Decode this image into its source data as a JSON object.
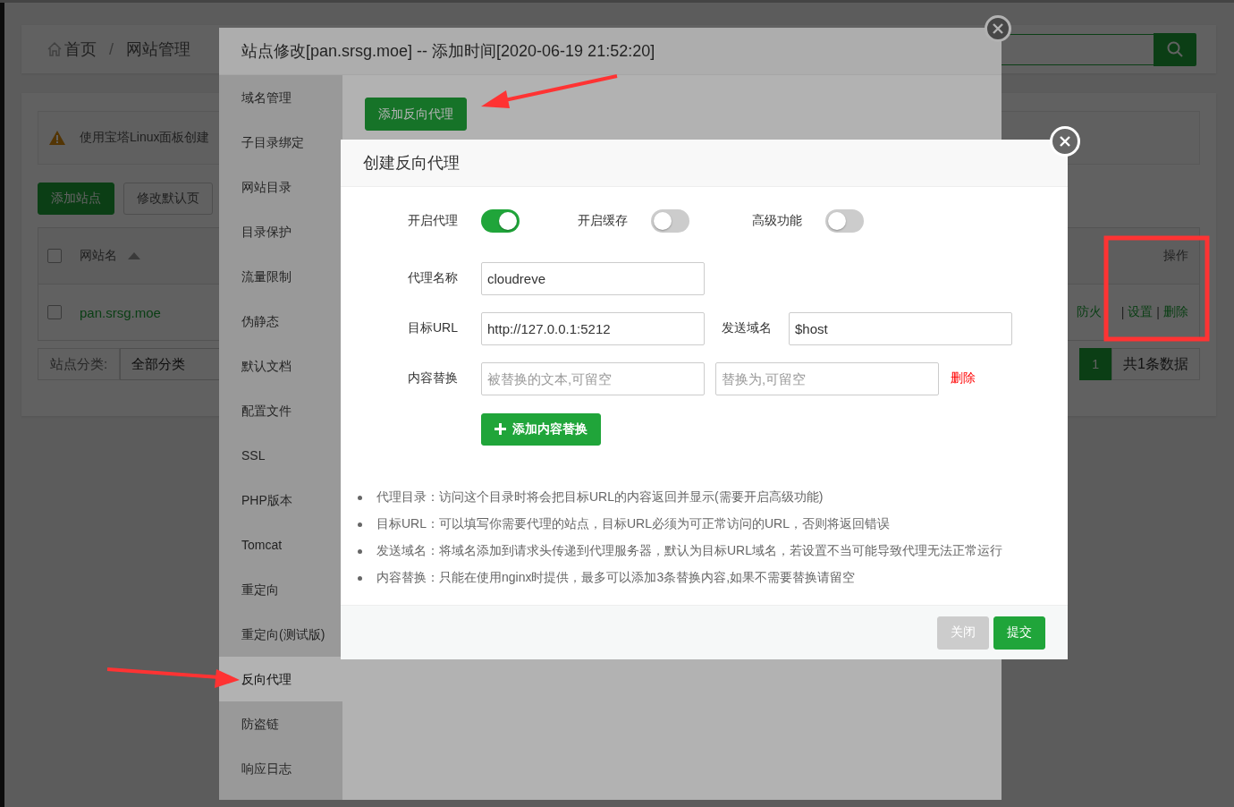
{
  "breadcrumb": {
    "items": [
      {
        "label": "首页"
      },
      {
        "label": "网站管理"
      }
    ],
    "separator": "/"
  },
  "notice": "使用宝塔Linux面板创建",
  "toolbar_buttons": [
    {
      "label": "添加站点",
      "primary": true
    },
    {
      "label": "修改默认页",
      "primary": false
    }
  ],
  "site_table": {
    "header_checked": false,
    "columns": [
      "网站名",
      "操作"
    ],
    "action_separator": "|",
    "rows": [
      {
        "checked": false,
        "name": "pan.srsg.moe",
        "actions": [
          "防火",
          "设置",
          "删除"
        ]
      }
    ]
  },
  "category": {
    "label": "站点分类:",
    "value": "全部分类"
  },
  "pagination": {
    "pages": [
      {
        "label": "1",
        "selected": true
      }
    ],
    "total": "共1条数据"
  },
  "site_dialog": {
    "title": "站点修改[pan.srsg.moe] -- 添加时间[2020-06-19 21:52:20]",
    "tabs": [
      {
        "label": "域名管理",
        "selected": false
      },
      {
        "label": "子目录绑定",
        "selected": false
      },
      {
        "label": "网站目录",
        "selected": false
      },
      {
        "label": "目录保护",
        "selected": false
      },
      {
        "label": "流量限制",
        "selected": false
      },
      {
        "label": "伪静态",
        "selected": false
      },
      {
        "label": "默认文档",
        "selected": false
      },
      {
        "label": "配置文件",
        "selected": false
      },
      {
        "label": "SSL",
        "selected": false
      },
      {
        "label": "PHP版本",
        "selected": false
      },
      {
        "label": "Tomcat",
        "selected": false
      },
      {
        "label": "重定向",
        "selected": false
      },
      {
        "label": "重定向(测试版)",
        "selected": false
      },
      {
        "label": "反向代理",
        "selected": true
      },
      {
        "label": "防盗链",
        "selected": false
      },
      {
        "label": "响应日志",
        "selected": false
      }
    ],
    "add_button": "添加反向代理"
  },
  "proxy_dialog": {
    "title": "创建反向代理",
    "switches": [
      {
        "label": "开启代理",
        "on": true
      },
      {
        "label": "开启缓存",
        "on": false
      },
      {
        "label": "高级功能",
        "on": false
      }
    ],
    "name_field": {
      "label": "代理名称",
      "value": "cloudreve"
    },
    "target_field": {
      "label": "目标URL",
      "value": "http://127.0.0.1:5212"
    },
    "host_field": {
      "label": "发送域名",
      "value": "$host"
    },
    "replace": {
      "label": "内容替换",
      "from_placeholder": "被替换的文本,可留空",
      "to_placeholder": "替换为,可留空",
      "delete_link": "删除"
    },
    "add_replace_button": "添加内容替换",
    "notes": [
      "代理目录：访问这个目录时将会把目标URL的内容返回并显示(需要开启高级功能)",
      "目标URL：可以填写你需要代理的站点，目标URL必须为可正常访问的URL，否则将返回错误",
      "发送域名：将域名添加到请求头传递到代理服务器，默认为目标URL域名，若设置不当可能导致代理无法正常运行",
      "内容替换：只能在使用nginx时提供，最多可以添加3条替换内容,如果不需要替换请留空"
    ],
    "buttons": [
      {
        "label": "关闭",
        "primary": false
      },
      {
        "label": "提交",
        "primary": true
      }
    ]
  }
}
